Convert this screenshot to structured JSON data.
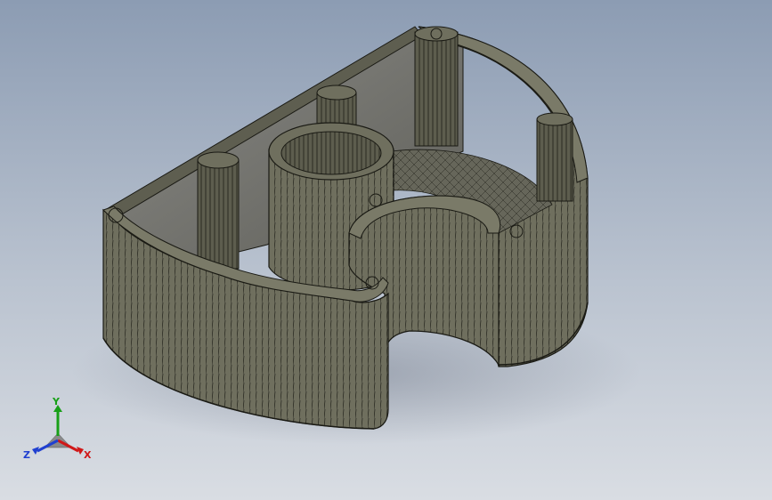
{
  "viewport": {
    "background_top": "#8c9cb3",
    "background_bottom": "#d9dde3",
    "model_color": "#6f6f5e",
    "model_dark": "#4f4f42",
    "edge_color": "#1a1a14"
  },
  "triad": {
    "x_label": "X",
    "y_label": "Y",
    "z_label": "Z",
    "x_color": "#d01818",
    "y_color": "#18a018",
    "z_color": "#2040d0"
  }
}
